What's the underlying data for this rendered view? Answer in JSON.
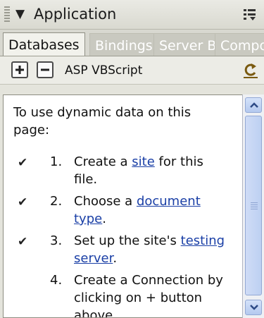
{
  "panel": {
    "title": "Application",
    "colors": {
      "header_bg": "#d9d9d0",
      "link": "#1a3fa6"
    }
  },
  "tabs": [
    {
      "label": "Databases",
      "active": true
    },
    {
      "label": "Bindings",
      "active": false
    },
    {
      "label": "Server B",
      "active": false
    },
    {
      "label": "Compone",
      "active": false
    }
  ],
  "toolbar": {
    "add_icon": "plus-icon",
    "remove_icon": "minus-icon",
    "document_type": "ASP VBScript",
    "refresh_icon": "refresh-icon"
  },
  "content": {
    "intro": "To use dynamic data on this page:",
    "steps": [
      {
        "checked": true,
        "num": "1.",
        "before": "Create a ",
        "link": "site",
        "after": " for this file."
      },
      {
        "checked": true,
        "num": "2.",
        "before": "Choose a ",
        "link": "document type",
        "after": "."
      },
      {
        "checked": true,
        "num": "3.",
        "before": "Set up the site's ",
        "link": "testing server",
        "after": "."
      },
      {
        "checked": false,
        "num": "4.",
        "before": "Create a Connection by clicking on + button above.",
        "link": "",
        "after": ""
      }
    ],
    "check_glyph": "✔"
  }
}
